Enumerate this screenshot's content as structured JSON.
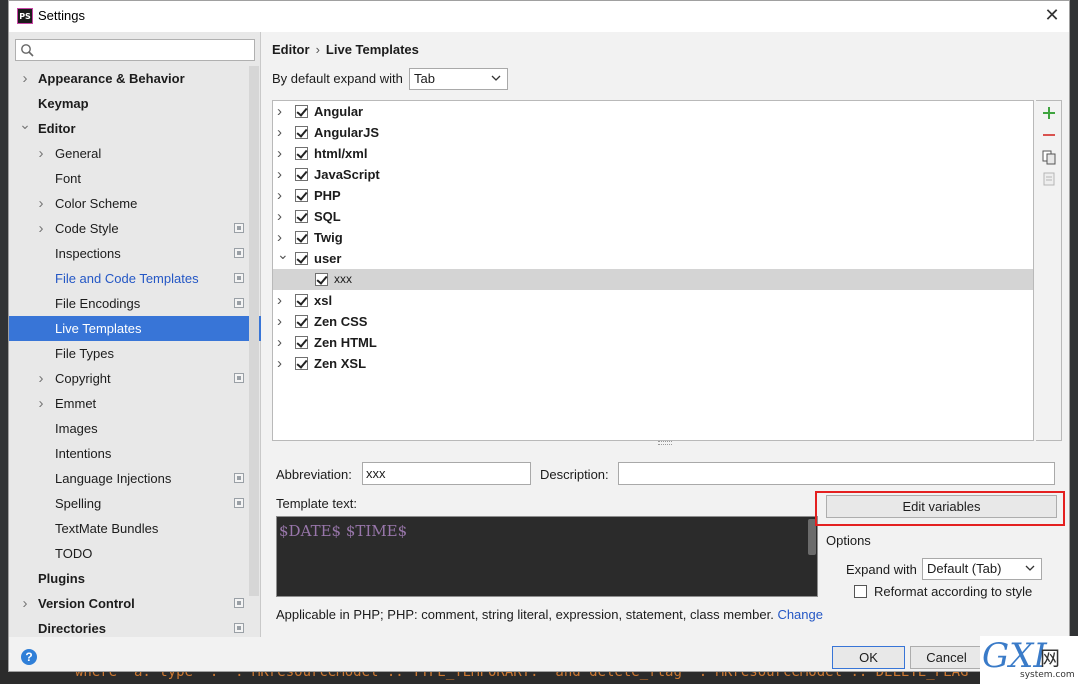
{
  "window": {
    "title": "Settings",
    "logo": "PS"
  },
  "search": {
    "placeholder": ""
  },
  "sidebar": {
    "items": [
      {
        "label": "Appearance & Behavior",
        "level": 0,
        "bold": true,
        "chevron": "right"
      },
      {
        "label": "Keymap",
        "level": 0,
        "bold": true
      },
      {
        "label": "Editor",
        "level": 0,
        "bold": true,
        "chevron": "down"
      },
      {
        "label": "General",
        "level": 1,
        "chevron": "right"
      },
      {
        "label": "Font",
        "level": 1
      },
      {
        "label": "Color Scheme",
        "level": 1,
        "chevron": "right"
      },
      {
        "label": "Code Style",
        "level": 1,
        "chevron": "right",
        "project": true
      },
      {
        "label": "Inspections",
        "level": 1,
        "project": true
      },
      {
        "label": "File and Code Templates",
        "level": 1,
        "project": true,
        "link": true
      },
      {
        "label": "File Encodings",
        "level": 1,
        "project": true
      },
      {
        "label": "Live Templates",
        "level": 1,
        "selected": true
      },
      {
        "label": "File Types",
        "level": 1
      },
      {
        "label": "Copyright",
        "level": 1,
        "chevron": "right",
        "project": true
      },
      {
        "label": "Emmet",
        "level": 1,
        "chevron": "right"
      },
      {
        "label": "Images",
        "level": 1
      },
      {
        "label": "Intentions",
        "level": 1
      },
      {
        "label": "Language Injections",
        "level": 1,
        "project": true
      },
      {
        "label": "Spelling",
        "level": 1,
        "project": true
      },
      {
        "label": "TextMate Bundles",
        "level": 1
      },
      {
        "label": "TODO",
        "level": 1
      },
      {
        "label": "Plugins",
        "level": 0,
        "bold": true
      },
      {
        "label": "Version Control",
        "level": 0,
        "bold": true,
        "chevron": "right",
        "project": true
      },
      {
        "label": "Directories",
        "level": 0,
        "bold": true,
        "project": true
      }
    ]
  },
  "breadcrumb": {
    "parent": "Editor",
    "separator": "›",
    "current": "Live Templates"
  },
  "expand_default": {
    "label": "By default expand with",
    "value": "Tab"
  },
  "templates": [
    {
      "name": "Angular",
      "checked": true,
      "expanded": false
    },
    {
      "name": "AngularJS",
      "checked": true,
      "expanded": false
    },
    {
      "name": "html/xml",
      "checked": true,
      "expanded": false
    },
    {
      "name": "JavaScript",
      "checked": true,
      "expanded": false
    },
    {
      "name": "PHP",
      "checked": true,
      "expanded": false
    },
    {
      "name": "SQL",
      "checked": true,
      "expanded": false
    },
    {
      "name": "Twig",
      "checked": true,
      "expanded": false
    },
    {
      "name": "user",
      "checked": true,
      "expanded": true
    },
    {
      "name": "xxx",
      "checked": true,
      "child": true,
      "highlighted": true
    },
    {
      "name": "xsl",
      "checked": true,
      "expanded": false
    },
    {
      "name": "Zen CSS",
      "checked": true,
      "expanded": false
    },
    {
      "name": "Zen HTML",
      "checked": true,
      "expanded": false
    },
    {
      "name": "Zen XSL",
      "checked": true,
      "expanded": false
    }
  ],
  "tools": {
    "add": "plus-icon",
    "remove": "minus-icon",
    "copy": "copy-icon",
    "restore": "restore-icon"
  },
  "editor": {
    "abbreviation_label": "Abbreviation:",
    "abbreviation_value": "xxx",
    "description_label": "Description:",
    "description_value": "",
    "template_text_label": "Template text:",
    "template_text": "$DATE$ $TIME$",
    "edit_variables_label": "Edit variables",
    "options_label": "Options",
    "expand_with_label": "Expand with",
    "expand_with_value": "Default (Tab)",
    "reformat_label": "Reformat according to style",
    "reformat_checked": false,
    "applicable_text": "Applicable in PHP; PHP: comment, string literal, expression, statement, class member.",
    "change_link": "Change"
  },
  "footer": {
    "ok_label": "OK",
    "cancel_label": "Cancel",
    "help": "?"
  },
  "background_code": "where  a. type  .  . MKresourceModel :: TYPE_TEMPORARY.  and delete_flag  . MKresourceModel :: DELETE_FLAG",
  "watermark": {
    "main": "GXI",
    "cn": "网",
    "sub": "system.com"
  },
  "colors": {
    "accent": "#3875d7",
    "link": "#2457c5",
    "highlight_frame": "#e42020",
    "code_bg": "#2b2b2b",
    "code_var": "#9876aa"
  }
}
